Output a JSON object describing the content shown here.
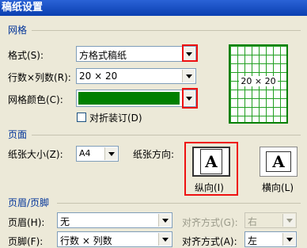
{
  "title": "稿纸设置",
  "grid_section": {
    "heading": "网格",
    "style_label": "格式(S):",
    "style_value": "方格式稿纸",
    "rowscols_label": "行数×列数(R):",
    "rowscols_value": "20 × 20",
    "color_label": "网格颜色(C):",
    "color_value": "#008000",
    "fold_label": "对折装订(D)",
    "fold_checked": false,
    "preview_text": "20 × 20"
  },
  "page_section": {
    "heading": "页面",
    "size_label": "纸张大小(Z):",
    "size_value": "A4",
    "orientation_label": "纸张方向:",
    "portrait_label": "纵向(I)",
    "landscape_label": "横向(L)",
    "selected": "portrait"
  },
  "header_footer_section": {
    "heading": "页眉/页脚",
    "header_label": "页眉(H):",
    "header_value": "无",
    "header_align_label": "对齐方式(G):",
    "header_align_value": "右",
    "footer_label": "页脚(F):",
    "footer_value": "行数 × 列数",
    "footer_align_label": "对齐方式(A):",
    "footer_align_value": "左"
  }
}
